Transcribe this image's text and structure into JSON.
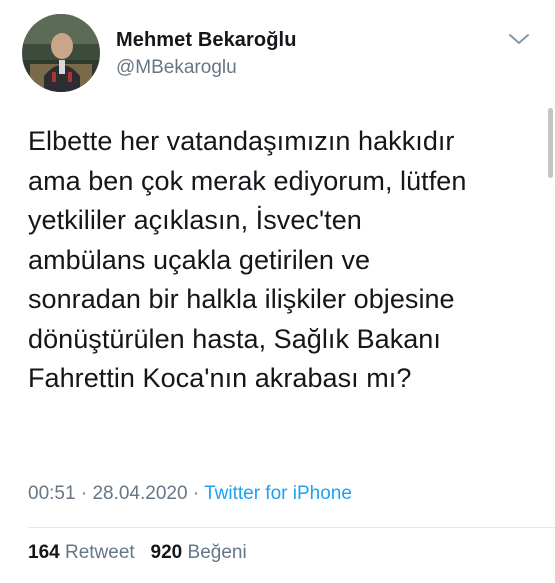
{
  "user": {
    "display_name": "Mehmet Bekaroğlu",
    "handle": "@MBekaroglu"
  },
  "tweet": {
    "lines": [
      "Elbette her vatandaşımızın hakkıdır",
      "ama ben çok merak ediyorum, lütfen",
      "yetkililer açıklasın, İsvec'ten",
      "ambülans uçakla getirilen ve",
      "sonradan bir halkla ilişkiler objesine",
      "dönüştürülen hasta, Sağlık Bakanı",
      "Fahrettin Koca'nın akrabası mı?"
    ]
  },
  "meta": {
    "time": "00:51",
    "separator": "·",
    "date": "28.04.2020",
    "source": "Twitter for iPhone"
  },
  "stats": {
    "retweets_count": "164",
    "retweets_label": "Retweet",
    "likes_count": "920",
    "likes_label": "Beğeni"
  },
  "icons": {
    "menu": "chevron-down-icon"
  },
  "colors": {
    "text": "#14171a",
    "secondary": "#657786",
    "link": "#1da1f2",
    "divider": "#e1e8ed"
  }
}
